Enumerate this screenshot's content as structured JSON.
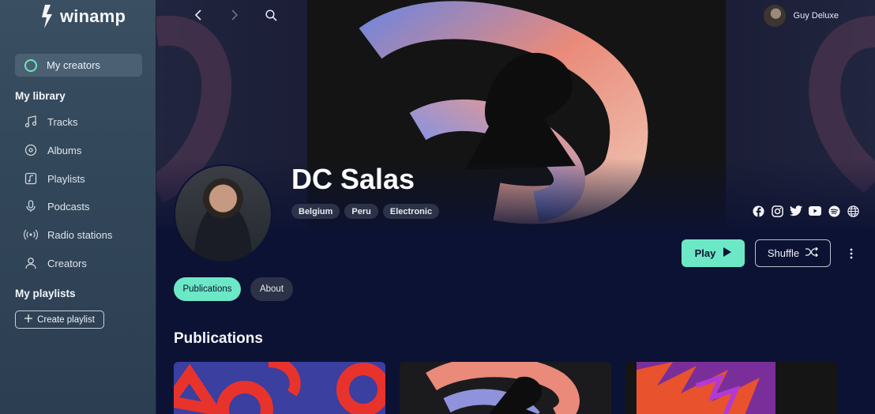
{
  "app": {
    "logo_text": "winamp"
  },
  "sidebar": {
    "my_creators_label": "My creators",
    "library_title": "My library",
    "items": [
      {
        "label": "Tracks",
        "icon": "music-note-icon"
      },
      {
        "label": "Albums",
        "icon": "disc-icon"
      },
      {
        "label": "Playlists",
        "icon": "playlist-icon"
      },
      {
        "label": "Podcasts",
        "icon": "microphone-icon"
      },
      {
        "label": "Radio stations",
        "icon": "radio-waves-icon"
      },
      {
        "label": "Creators",
        "icon": "person-icon"
      }
    ],
    "playlists_title": "My playlists",
    "create_playlist_label": "Create playlist"
  },
  "header": {
    "user_name": "Guy Deluxe"
  },
  "artist": {
    "name": "DC Salas",
    "tags": [
      "Belgium",
      "Peru",
      "Electronic"
    ],
    "socials": [
      "facebook-icon",
      "instagram-icon",
      "twitter-icon",
      "youtube-icon",
      "spotify-icon",
      "globe-icon"
    ]
  },
  "actions": {
    "play_label": "Play",
    "shuffle_label": "Shuffle"
  },
  "tabs": {
    "publications": "Publications",
    "about": "About"
  },
  "publications": {
    "title": "Publications"
  },
  "colors": {
    "accent": "#6de8c6",
    "background": "#0c1233",
    "sidebar": "#33475a"
  }
}
